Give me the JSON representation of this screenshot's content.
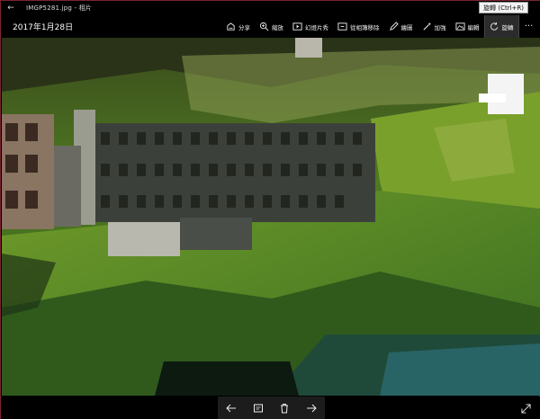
{
  "window": {
    "title": "IMGP5281.jpg - 相片",
    "back_glyph": "←",
    "tooltip": "旋轉 (Ctrl+R)"
  },
  "toolbar": {
    "date": "2017年1月28日",
    "share": {
      "label": "分享",
      "icon": "share-icon"
    },
    "zoom": {
      "label": "縮放",
      "icon": "zoom-icon"
    },
    "slideshow": {
      "label": "幻燈片秀",
      "icon": "slideshow-icon"
    },
    "remove_album": {
      "label": "從相簿移除",
      "icon": "remove-from-album-icon"
    },
    "draw": {
      "label": "繪圖",
      "icon": "pen-icon"
    },
    "enhance": {
      "label": "加強",
      "icon": "magic-wand-icon"
    },
    "edit": {
      "label": "編輯",
      "icon": "edit-photo-icon"
    },
    "rotate": {
      "label": "旋轉",
      "icon": "rotate-icon"
    },
    "more": "···"
  },
  "bottom": {
    "prev_icon": "arrow-left-icon",
    "info_icon": "info-icon",
    "delete_icon": "trash-icon",
    "next_icon": "arrow-right-icon",
    "fullscreen_icon": "expand-icon"
  },
  "colors": {
    "background": "#000000",
    "accent_border": "#7a2431",
    "active_tool": "#2b2b2b"
  }
}
